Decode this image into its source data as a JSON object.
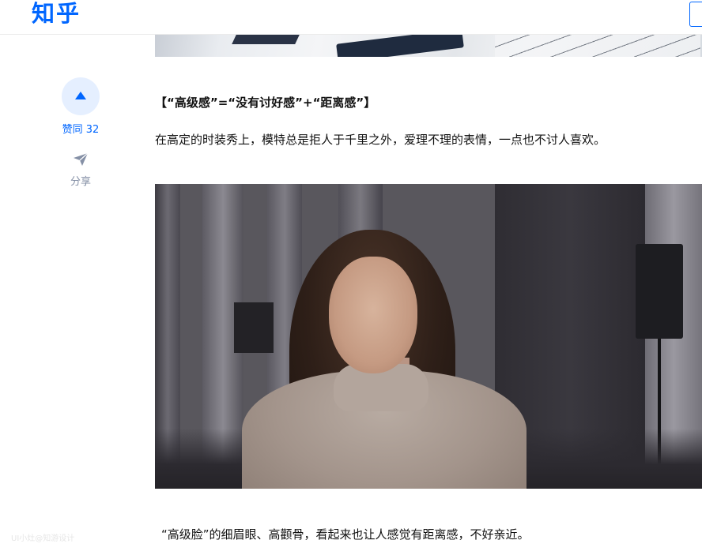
{
  "header": {
    "logo": "知乎"
  },
  "actions": {
    "vote_label": "赞同 32",
    "share_label": "分享"
  },
  "article": {
    "heading": "【“高级感”=“没有讨好感”+“距离感”】",
    "paragraph1": "在高定的时装秀上，模特总是拒人于千里之外，爱理不理的表情，一点也不讨人喜欢。",
    "paragraph2": "“高级脸”的细眉眼、高颧骨，看起来也让人感觉有距离感，不好亲近。",
    "watermark": "UI小灶@知游设计"
  },
  "colors": {
    "brand": "#0066ff",
    "muted": "#8590a6",
    "text": "#121212"
  },
  "icons": [
    "up-triangle-icon",
    "paper-plane-icon"
  ]
}
